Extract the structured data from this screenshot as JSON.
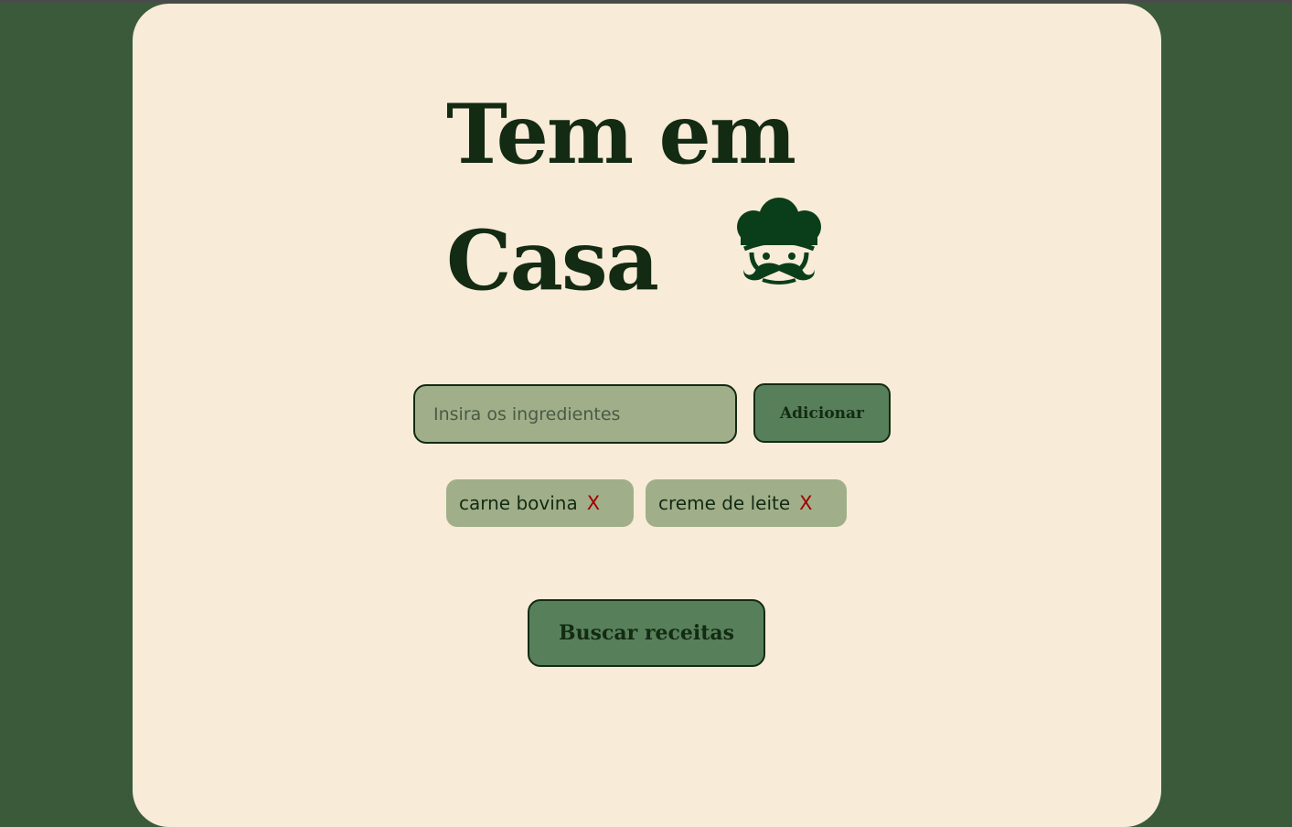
{
  "header": {
    "title_line1": "Tem em",
    "title_line2": "Casa",
    "logo_icon": "chef-hat-mustache-icon"
  },
  "ingredient_form": {
    "input_value": "",
    "input_placeholder": "Insira os ingredientes",
    "add_label": "Adicionar"
  },
  "ingredients": [
    {
      "label": "carne bovina",
      "remove": "X"
    },
    {
      "label": "creme de leite",
      "remove": "X"
    }
  ],
  "search": {
    "label": "Buscar receitas"
  },
  "colors": {
    "background": "#3a5a3a",
    "card": "#f8ebd7",
    "text": "#132a13",
    "input": "#a0af89",
    "button": "#57805a",
    "remove": "#a00000"
  }
}
